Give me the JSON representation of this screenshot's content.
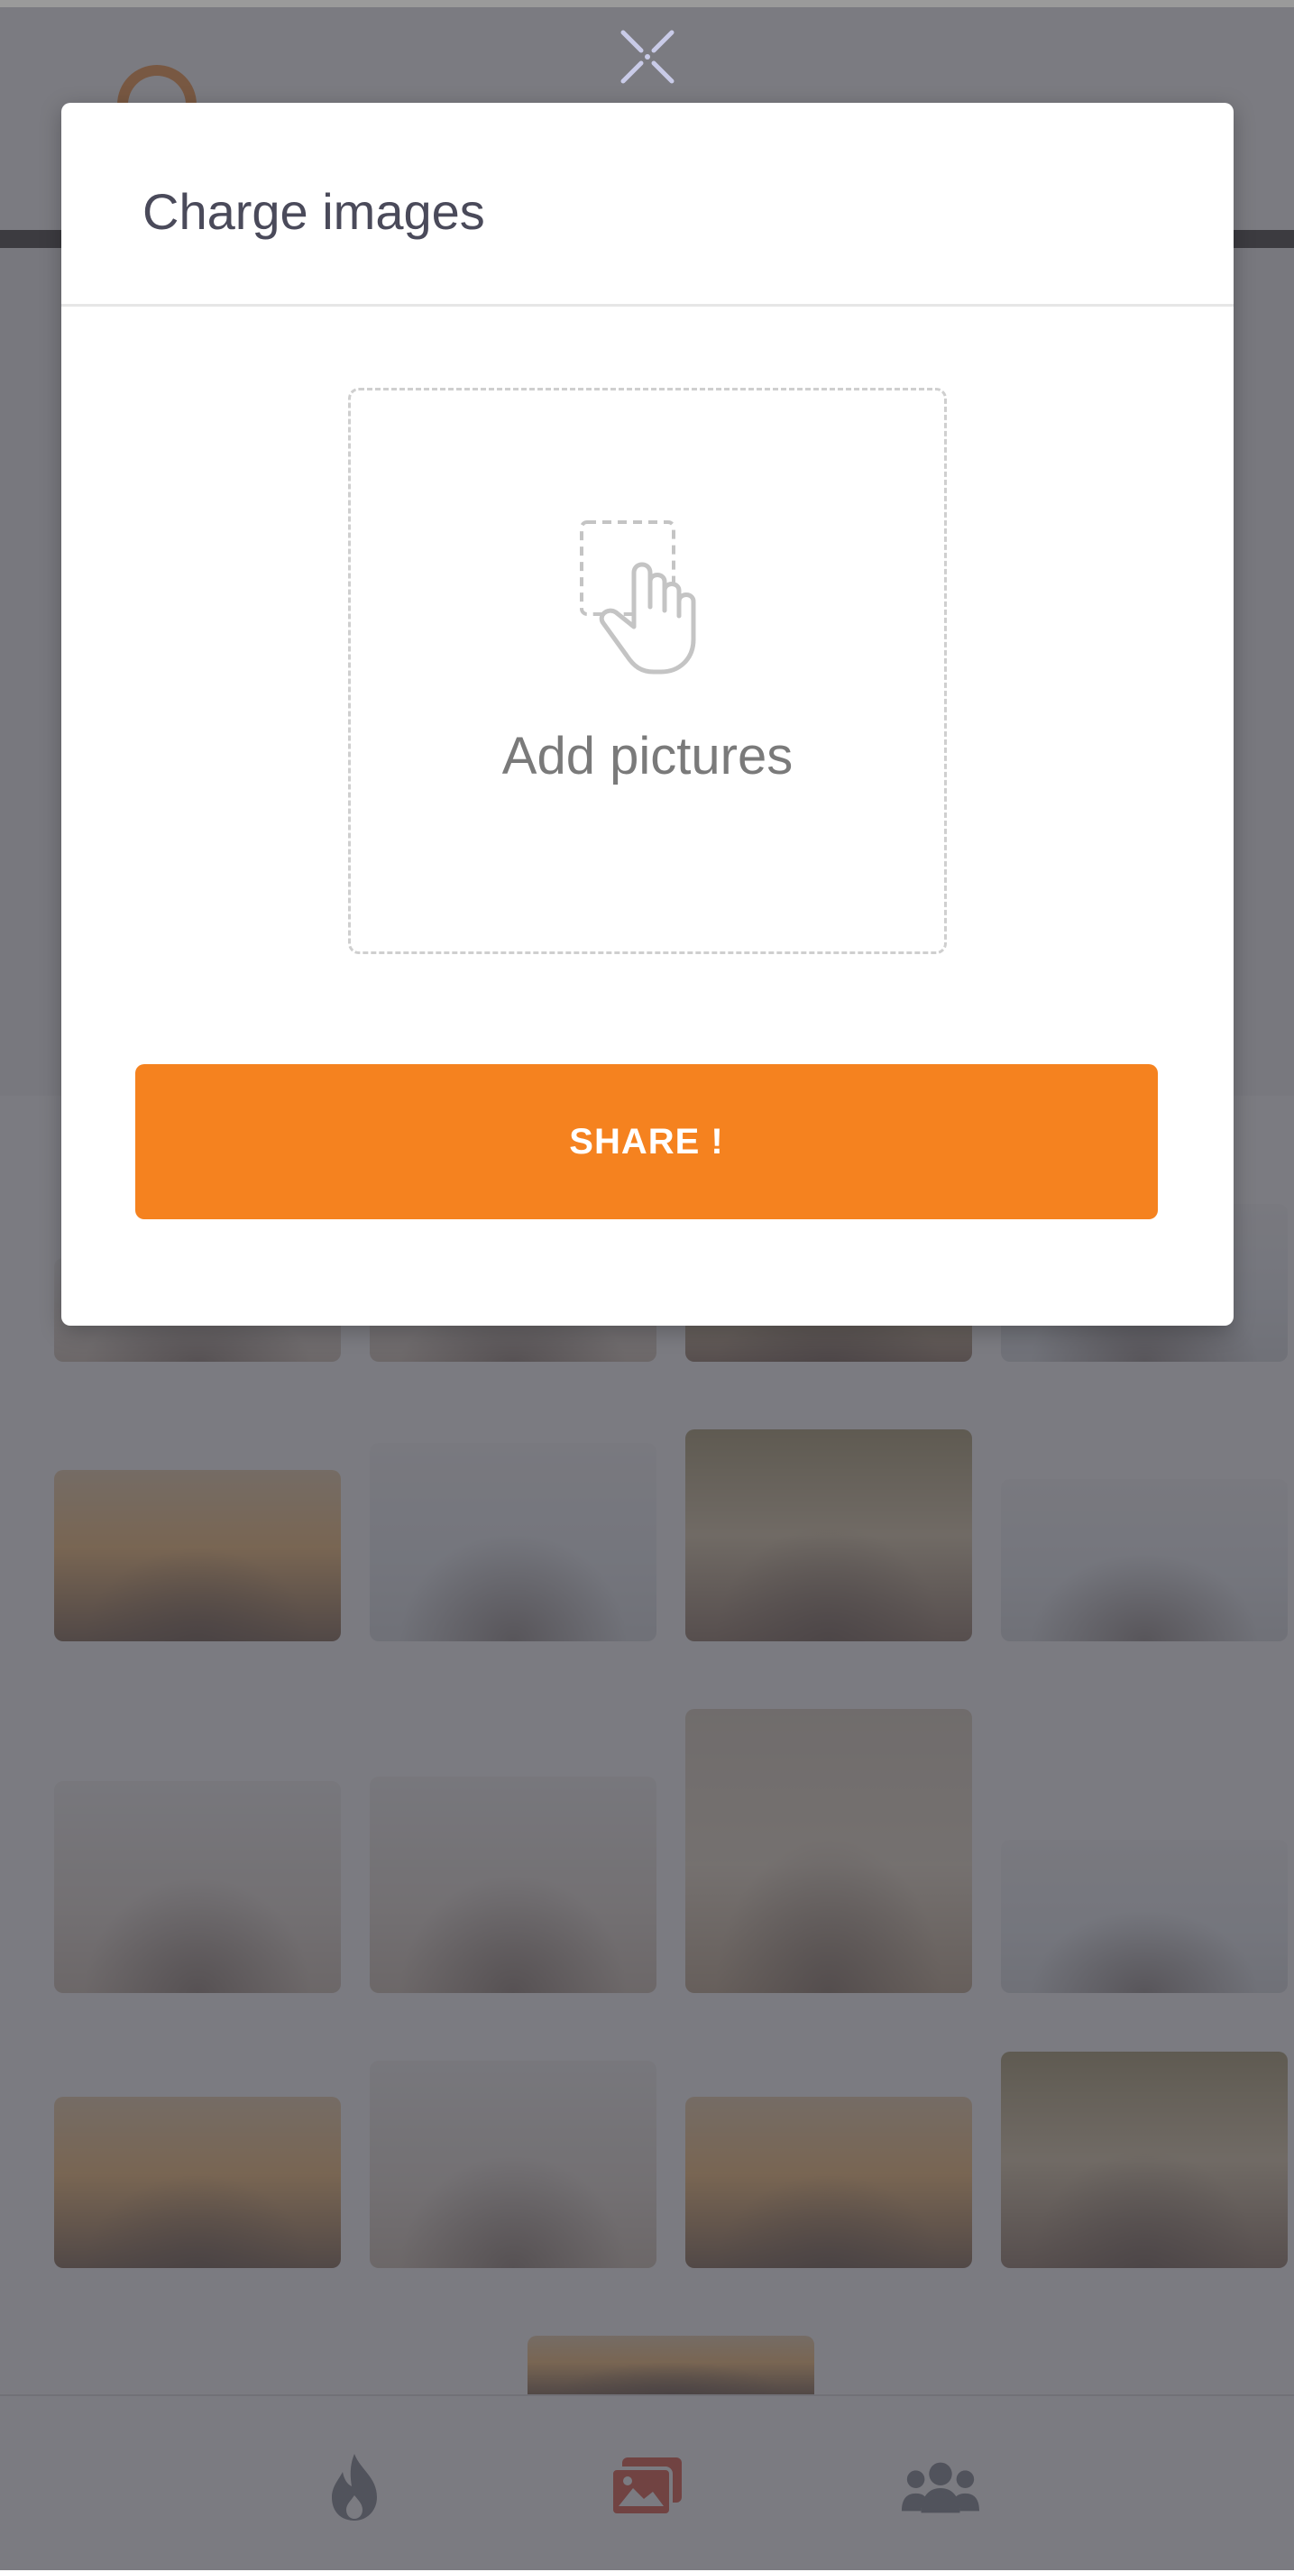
{
  "modal": {
    "title": "Charge images",
    "dropzone_label": "Add pictures",
    "share_label": "SHARE !"
  },
  "colors": {
    "accent": "#f5821f",
    "overlay": "#484850",
    "nav_active": "#d9381e",
    "nav_inactive": "#6a6f7a"
  },
  "icons": {
    "close": "close-icon",
    "dropzone": "tap-select-icon",
    "nav": [
      "flame-icon",
      "gallery-icon",
      "group-icon"
    ]
  },
  "bottom_nav": {
    "active_index": 1
  }
}
